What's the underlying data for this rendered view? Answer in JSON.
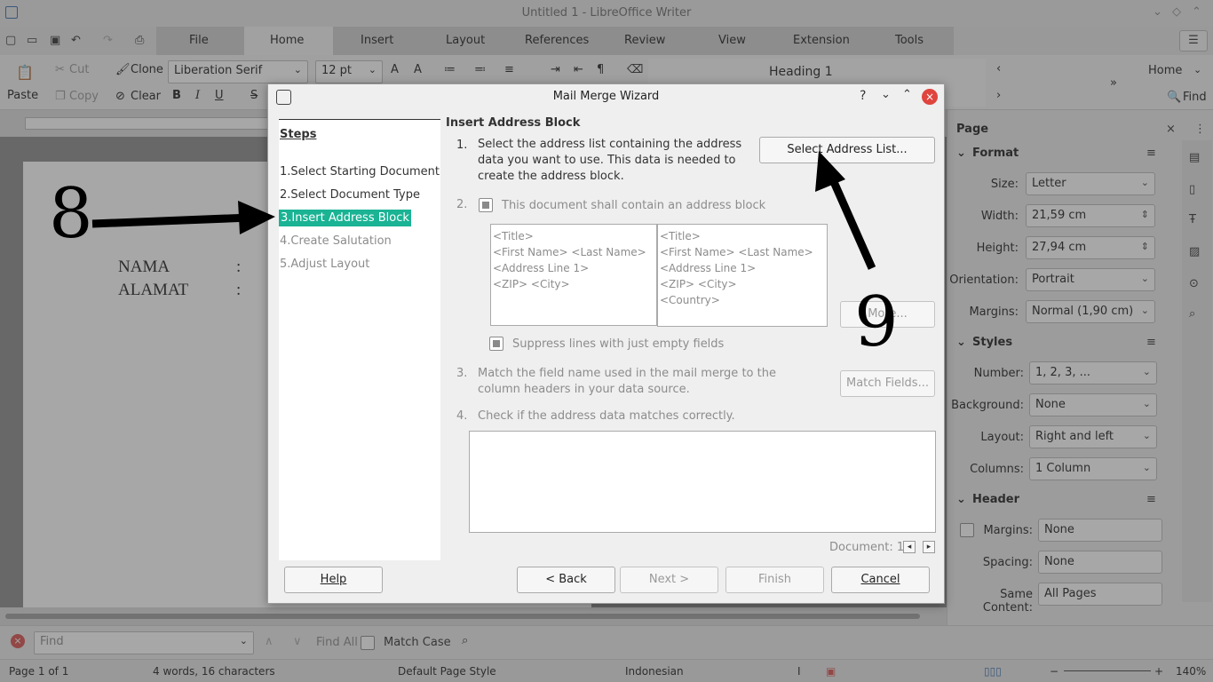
{
  "app": {
    "title": "Untitled 1 - LibreOffice Writer"
  },
  "menu_tabs": [
    "File",
    "Home",
    "Insert",
    "Layout",
    "References",
    "Review",
    "View",
    "Extension",
    "Tools"
  ],
  "ribbon": {
    "cut": "Cut",
    "copy": "Copy",
    "paste": "Paste",
    "clone": "Clone",
    "clear": "Clear",
    "font_name": "Liberation Serif",
    "font_size": "12 pt",
    "style": "Heading 1",
    "home_dd": "Home",
    "find": "Find"
  },
  "document": {
    "line1_label": "NAMA",
    "line1_colon": ":",
    "line2_label": "ALAMAT",
    "line2_colon": ":"
  },
  "sidebar": {
    "title": "Page",
    "format_head": "Format",
    "size_label": "Size:",
    "size_value": "Letter",
    "width_label": "Width:",
    "width_value": "21,59 cm",
    "height_label": "Height:",
    "height_value": "27,94 cm",
    "orientation_label": "Orientation:",
    "orientation_value": "Portrait",
    "margins_label": "Margins:",
    "margins_value": "Normal (1,90 cm)",
    "styles_head": "Styles",
    "number_label": "Number:",
    "number_value": "1, 2, 3, ...",
    "background_label": "Background:",
    "background_value": "None",
    "layout_label": "Layout:",
    "layout_value": "Right and left",
    "columns_label": "Columns:",
    "columns_value": "1 Column",
    "header_head": "Header",
    "hmargins_label": "Margins:",
    "hmargins_value": "None",
    "spacing_label": "Spacing:",
    "spacing_value": "None",
    "same_label": "Same Content:",
    "same_value": "All Pages"
  },
  "findbar": {
    "placeholder": "Find",
    "find_all": "Find All",
    "match_case": "Match Case"
  },
  "status": {
    "page": "Page 1 of 1",
    "words": "4 words, 16 characters",
    "style": "Default Page Style",
    "lang": "Indonesian",
    "zoom": "140%"
  },
  "dialog": {
    "title": "Mail Merge Wizard",
    "steps_heading": "Steps",
    "steps": [
      "1.Select Starting Document",
      "2.Select Document Type",
      "3.Insert Address Block",
      "4.Create Salutation",
      "5.Adjust Layout"
    ],
    "active_step": 2,
    "section_title": "Insert Address Block",
    "s1_num": "1.",
    "s1_text": "Select the address list containing the address data you want to use. This data is needed to create the address block.",
    "select_btn": "Select Address List...",
    "s2_num": "2.",
    "s2_check": "This document shall contain an address block",
    "preview1": [
      "<Title>",
      "<First Name> <Last Name>",
      "<Address Line 1>",
      "<ZIP> <City>"
    ],
    "preview2": [
      "<Title>",
      "<First Name> <Last Name>",
      "<Address Line 1>",
      "<ZIP> <City>",
      "<Country>"
    ],
    "more_btn": "More...",
    "suppress_check": "Suppress lines with just empty fields",
    "s3_num": "3.",
    "s3_text": "Match the field name used in the mail merge to the column headers in your data source.",
    "match_btn": "Match Fields...",
    "s4_num": "4.",
    "s4_text": "Check if the address data matches correctly.",
    "document_label": "Document: 1",
    "help_btn": "Help",
    "back_btn": "< Back",
    "next_btn": "Next >",
    "finish_btn": "Finish",
    "cancel_btn": "Cancel"
  },
  "annotations": {
    "num8": "8",
    "num9": "9"
  }
}
